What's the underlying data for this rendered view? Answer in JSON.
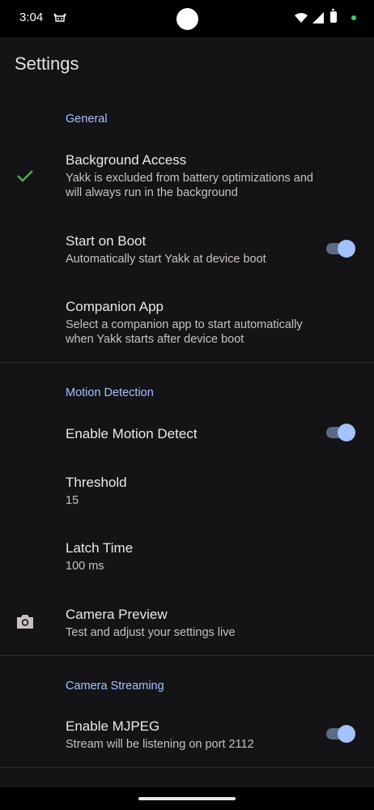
{
  "status": {
    "time": "3:04"
  },
  "title": "Settings",
  "sections": [
    {
      "header": "General",
      "items": [
        {
          "title": "Background Access",
          "summary": "Yakk is excluded from battery optimizations and will always run in the background",
          "icon": "check-icon"
        },
        {
          "title": "Start on Boot",
          "summary": "Automatically start Yakk at device boot",
          "switch": true
        },
        {
          "title": "Companion App",
          "summary": "Select a companion app to start automatically when Yakk starts after device boot"
        }
      ]
    },
    {
      "header": "Motion Detection",
      "items": [
        {
          "title": "Enable Motion Detect",
          "switch": true
        },
        {
          "title": "Threshold",
          "summary": "15"
        },
        {
          "title": "Latch Time",
          "summary": "100 ms"
        },
        {
          "title": "Camera Preview",
          "summary": "Test and adjust your settings live",
          "icon": "camera-icon"
        }
      ]
    },
    {
      "header": "Camera Streaming",
      "items": [
        {
          "title": "Enable MJPEG",
          "summary": "Stream will be listening on port 2112",
          "switch": true
        }
      ]
    }
  ],
  "colors": {
    "accent": "#a4c2ff",
    "check": "#4caf50",
    "background": "#141316"
  }
}
